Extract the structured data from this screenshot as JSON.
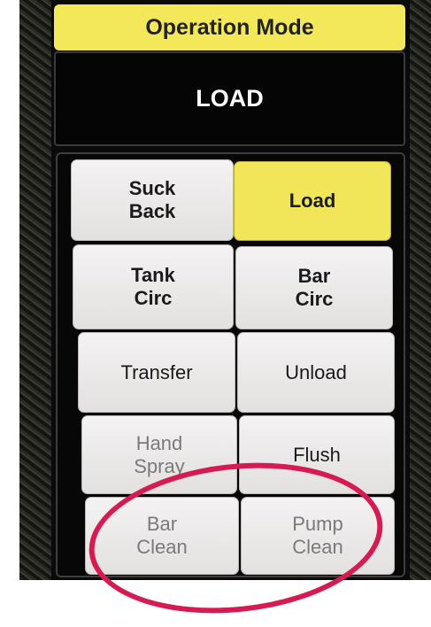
{
  "header": {
    "title": "Operation Mode"
  },
  "current_mode": {
    "value": "LOAD"
  },
  "buttons": [
    {
      "label": "Suck\nBack"
    },
    {
      "label": "Load"
    },
    {
      "label": "Tank\nCirc"
    },
    {
      "label": "Bar\nCirc"
    },
    {
      "label": "Transfer"
    },
    {
      "label": "Unload"
    },
    {
      "label": "Hand\nSpray"
    },
    {
      "label": "Flush"
    },
    {
      "label": "Bar\nClean"
    },
    {
      "label": "Pump\nClean"
    }
  ],
  "colors": {
    "header": "#f2e85a",
    "active_button": "#f1e65a",
    "annotation_ring": "#d61b52"
  }
}
